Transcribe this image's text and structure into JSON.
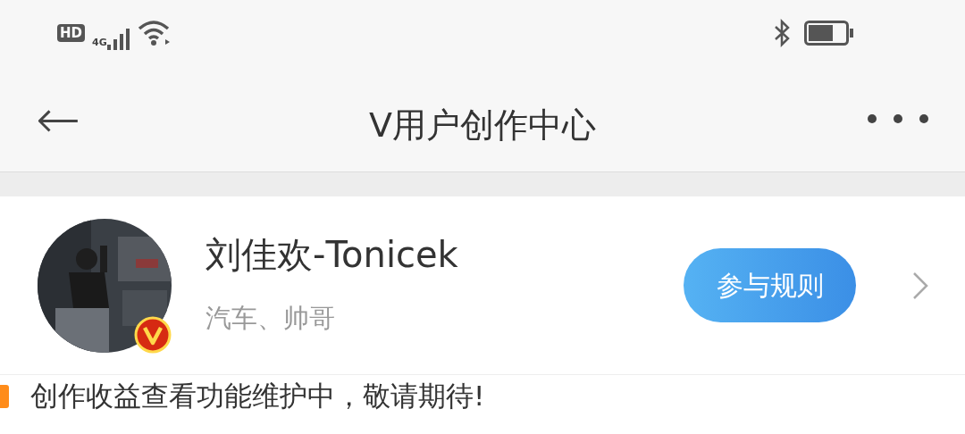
{
  "status_bar": {
    "hd": "HD",
    "network": "4G"
  },
  "header": {
    "back": "←",
    "title": "V用户创作中心"
  },
  "profile": {
    "name": "刘佳欢-Tonicek",
    "tags": "汽车、帅哥",
    "verified": true,
    "rules_button": "参与规则"
  },
  "notice": {
    "text": "创作收益查看功能维护中，敬请期待!",
    "color": "#ff8c1a"
  }
}
